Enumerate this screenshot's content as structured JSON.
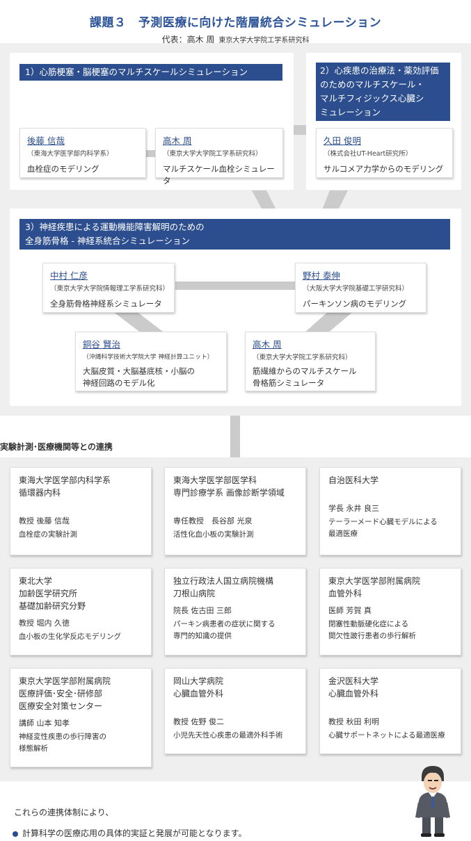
{
  "header": {
    "title": "課題３　予測医療に向けた階層統合シミュレーション",
    "representative": "代表：高木 周",
    "representative_affiliation": "東京大学大学院工学系研究科"
  },
  "groups": [
    {
      "title": "1）心筋梗塞・脳梗塞のマルチスケールシミュレーション",
      "members": [
        {
          "name": "後藤 信哉",
          "affiliation": "（東海大学医学部内科学系）",
          "desc": "血栓症のモデリング"
        },
        {
          "name": "高木 周",
          "affiliation": "（東京大学大学院工学系研究科）",
          "desc": "マルチスケール血栓シミュレータ"
        }
      ]
    },
    {
      "title": "2）心疾患の治療法・薬効評価\nのためのマルチスケール・\nマルチフィジックス心臓シ\nミュレーション",
      "members": [
        {
          "name": "久田 俊明",
          "affiliation": "（株式会社UT-Heart研究所）",
          "desc": "サルコメア力学からのモデリング"
        }
      ]
    },
    {
      "title": "3）神経疾患による運動機能障害解明のための\n全身筋骨格 - 神経系統合シミュレーション",
      "members": [
        {
          "name": "中村 仁彦",
          "affiliation": "（東京大学大学院情報理工学系研究科）",
          "desc": "全身筋骨格神経系シミュレータ"
        },
        {
          "name": "野村 泰伸",
          "affiliation": "（大阪大学大学院基礎工学研究科）",
          "desc": "パーキンソン病のモデリング"
        },
        {
          "name": "銅谷 賢治",
          "affiliation": "（沖縄科学技術大学院大学 神経計算ユニット）",
          "desc": "大脳皮質・大脳基底核・小脳の\n神経回路のモデル化"
        },
        {
          "name": "高木 周",
          "affiliation": "（東京大学大学院工学系研究科）",
          "desc": "筋繊維からのマルチスケール\n骨格筋シミュレータ"
        }
      ]
    }
  ],
  "collaboration": {
    "heading": "実験計測･医療機関等との連携",
    "institutions": [
      {
        "org": "東海大学医学部内科学系\n循環器内科",
        "person": "教授 後藤 信哉",
        "topic": "血栓症の実験計測"
      },
      {
        "org": "東海大学医学部医学科\n専門診療学系 画像診断学領域",
        "person": "専任教授　長谷部 光泉",
        "topic": "活性化血小板の実験計測"
      },
      {
        "org": "自治医科大学",
        "person": "学長 永井 良三",
        "topic": "テーラーメード心臓モデルによる\n最適医療"
      },
      {
        "org": "東北大学\n加齢医学研究所\n基礎加齢研究分野",
        "person": "教授 堀内 久徳",
        "topic": "血小板の生化学反応モデリング"
      },
      {
        "org": "独立行政法人国立病院機構\n刀根山病院",
        "person": "院長 佐古田 三郎",
        "topic": "パーキン病患者の症状に関する\n専門的知識の提供"
      },
      {
        "org": "東京大学医学部附属病院\n血管外科",
        "person": "医師 芳賀 真",
        "topic": "閉塞性動脈硬化症による\n間欠性跛行患者の歩行解析"
      },
      {
        "org": "東京大学医学部附属病院\n医療評価･安全･研修部\n医療安全対策センター",
        "person": "講師 山本 知孝",
        "topic": "神経変性疾患の歩行障害の\n様態解析"
      },
      {
        "org": "岡山大学病院\n心臓血管外科",
        "person": "教授 佐野 俊二",
        "topic": "小児先天性心疾患の最適外科手術"
      },
      {
        "org": "金沢医科大学\n心臓血管外科",
        "person": "教授 秋田 利明",
        "topic": "心臓サポートネットによる最適医療"
      }
    ]
  },
  "conclusion": {
    "intro": "これらの連携体制により、",
    "point": "計算科学の医療応用の具体的実証と発展が可能となります。"
  },
  "colors": {
    "band": "#2c4e8e",
    "title": "#2e5599",
    "background": "#efefef",
    "connector": "#cbcbcb"
  }
}
